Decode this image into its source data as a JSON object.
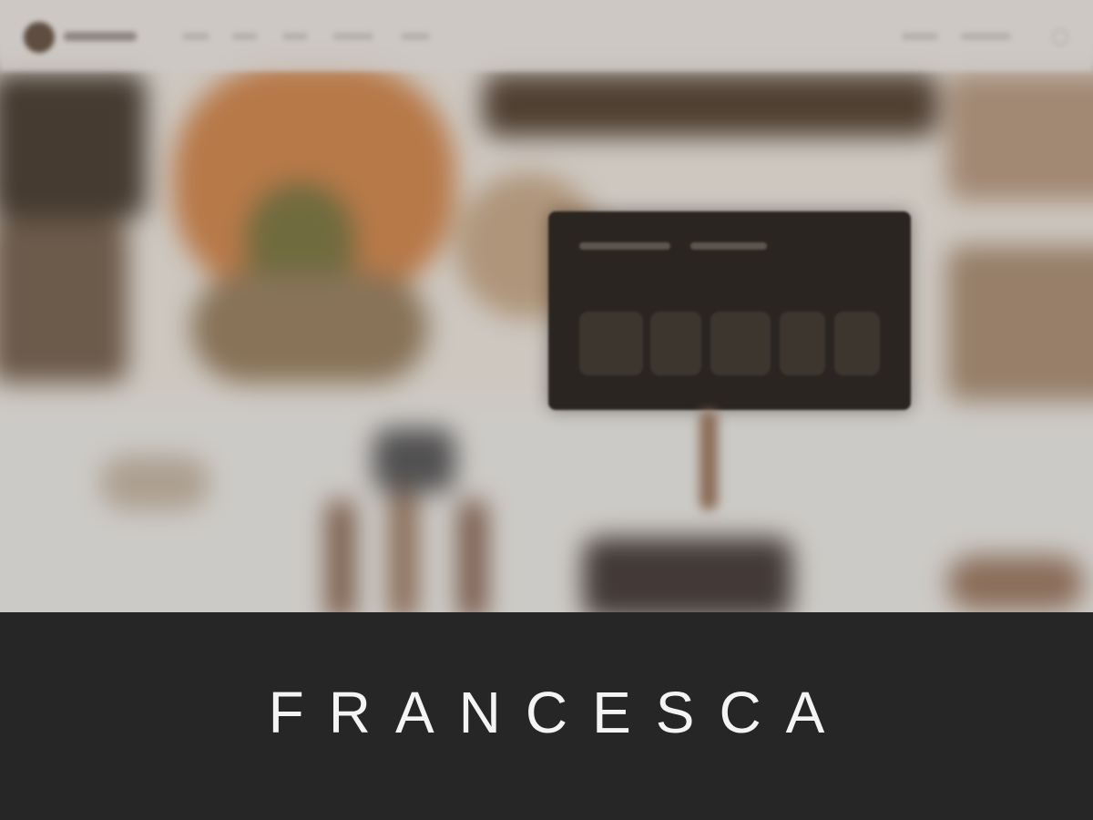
{
  "colors": {
    "footer_background": "#262626",
    "title_text": "#f4f4f4",
    "card_background": "#2a2521"
  },
  "icons": {
    "logo": "logo-mark-icon",
    "nav_action": "circle-icon"
  },
  "footer": {
    "title": "FRANCESCA"
  }
}
